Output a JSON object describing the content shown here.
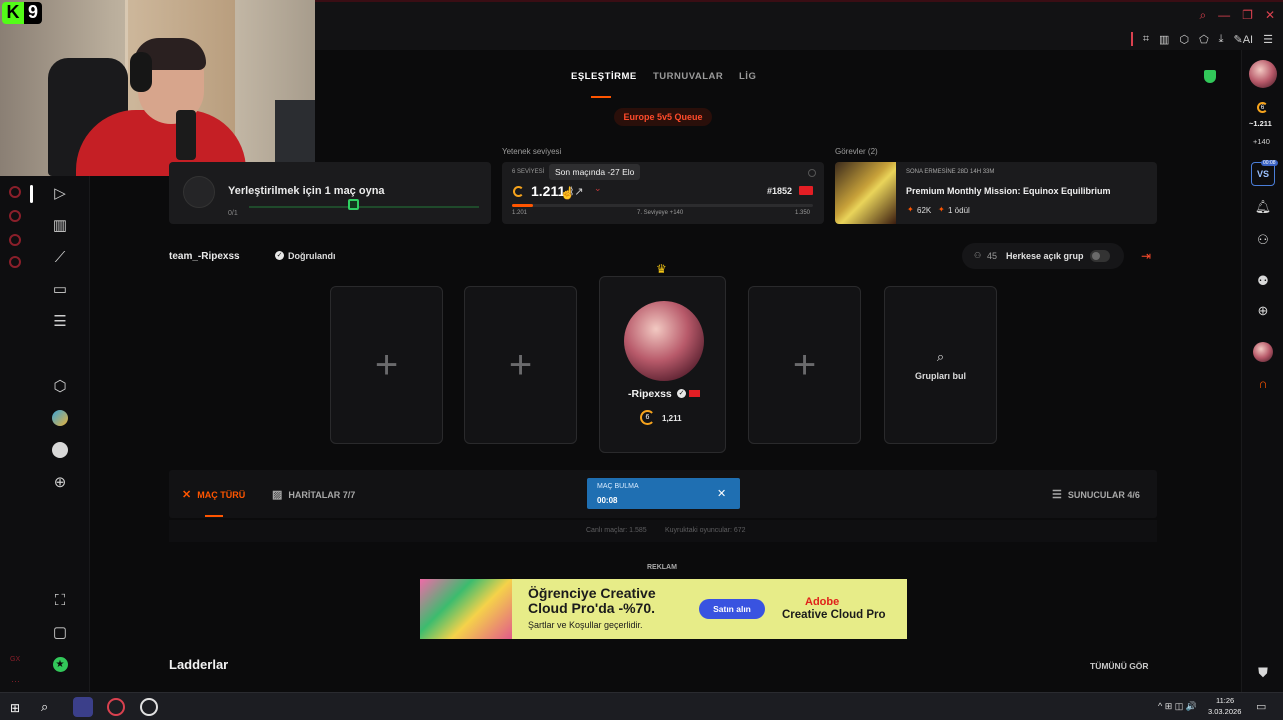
{
  "overlay": {
    "badge_k": "K",
    "badge_count": "9"
  },
  "topbar": {
    "tools": [
      "⌗",
      "▥",
      "⬡",
      "⬠",
      "⤓",
      "✎AI",
      "☰"
    ]
  },
  "nav": {
    "tabs": [
      "EŞLEŞTİRME",
      "TURNUVALAR",
      "LİG"
    ],
    "queue_label": "Europe 5v5 Queue"
  },
  "placement": {
    "title": "Yerleştirilmek için 1 maç oyna",
    "progress": "0/1",
    "progress_value": 0
  },
  "skill": {
    "section_label": "Yetenek seviyesi",
    "level_label": "6 SEVİYESİ",
    "elo": "1.211",
    "tooltip": "Son maçında -27 Elo",
    "rank": "#1852",
    "min": "1.201",
    "next": "7. Seviyeye +140",
    "max": "1.350",
    "progress_fraction": 0.07
  },
  "missions": {
    "section_label": "Görevler (2)",
    "timer": "SONA ERMESİNE 28D 14H 33M",
    "title": "Premium Monthly Mission: Equinox Equilibrium",
    "points": "62K",
    "reward": "1 ödül"
  },
  "team": {
    "name": "team_-Ripexss",
    "verified": "Doğrulandı",
    "group_count": "45",
    "group_label": "Herkese açık grup"
  },
  "party": {
    "player_name": "-Ripexss",
    "player_level": "6",
    "player_elo": "1,211",
    "find_groups": "Grupları bul"
  },
  "bottom": {
    "match_type": "MAÇ TÜRÜ",
    "maps": "HARİTALAR 7/7",
    "searching_label": "MAÇ BULMA",
    "searching_time": "00:08",
    "servers": "SUNUCULAR 4/6",
    "live_matches": "Canlı maçlar: 1.585",
    "queued_players": "Kuyruktaki oyuncular: 672"
  },
  "ad": {
    "label": "REKLAM",
    "headline": "Öğrenciye Creative Cloud Pro'da -%70.",
    "terms": "Şartlar ve Koşullar geçerlidir.",
    "cta": "Satın alın",
    "brand": "Adobe",
    "product": "Creative Cloud Pro"
  },
  "ladders": {
    "title": "Ladderlar",
    "see_all": "TÜMÜNÜ GÖR"
  },
  "rightbar": {
    "level": "6",
    "elo": "~1.211",
    "delta": "+140",
    "vs": "VS",
    "vs_badge": "00:08"
  },
  "taskbar": {
    "time": "11:26",
    "date": "3.03.2026",
    "tray": "^ ⊞ ◫ 🔊"
  },
  "colors": {
    "accent": "#ff5500",
    "brand_red": "#d9414f",
    "searching_blue": "#1f6fb2"
  }
}
